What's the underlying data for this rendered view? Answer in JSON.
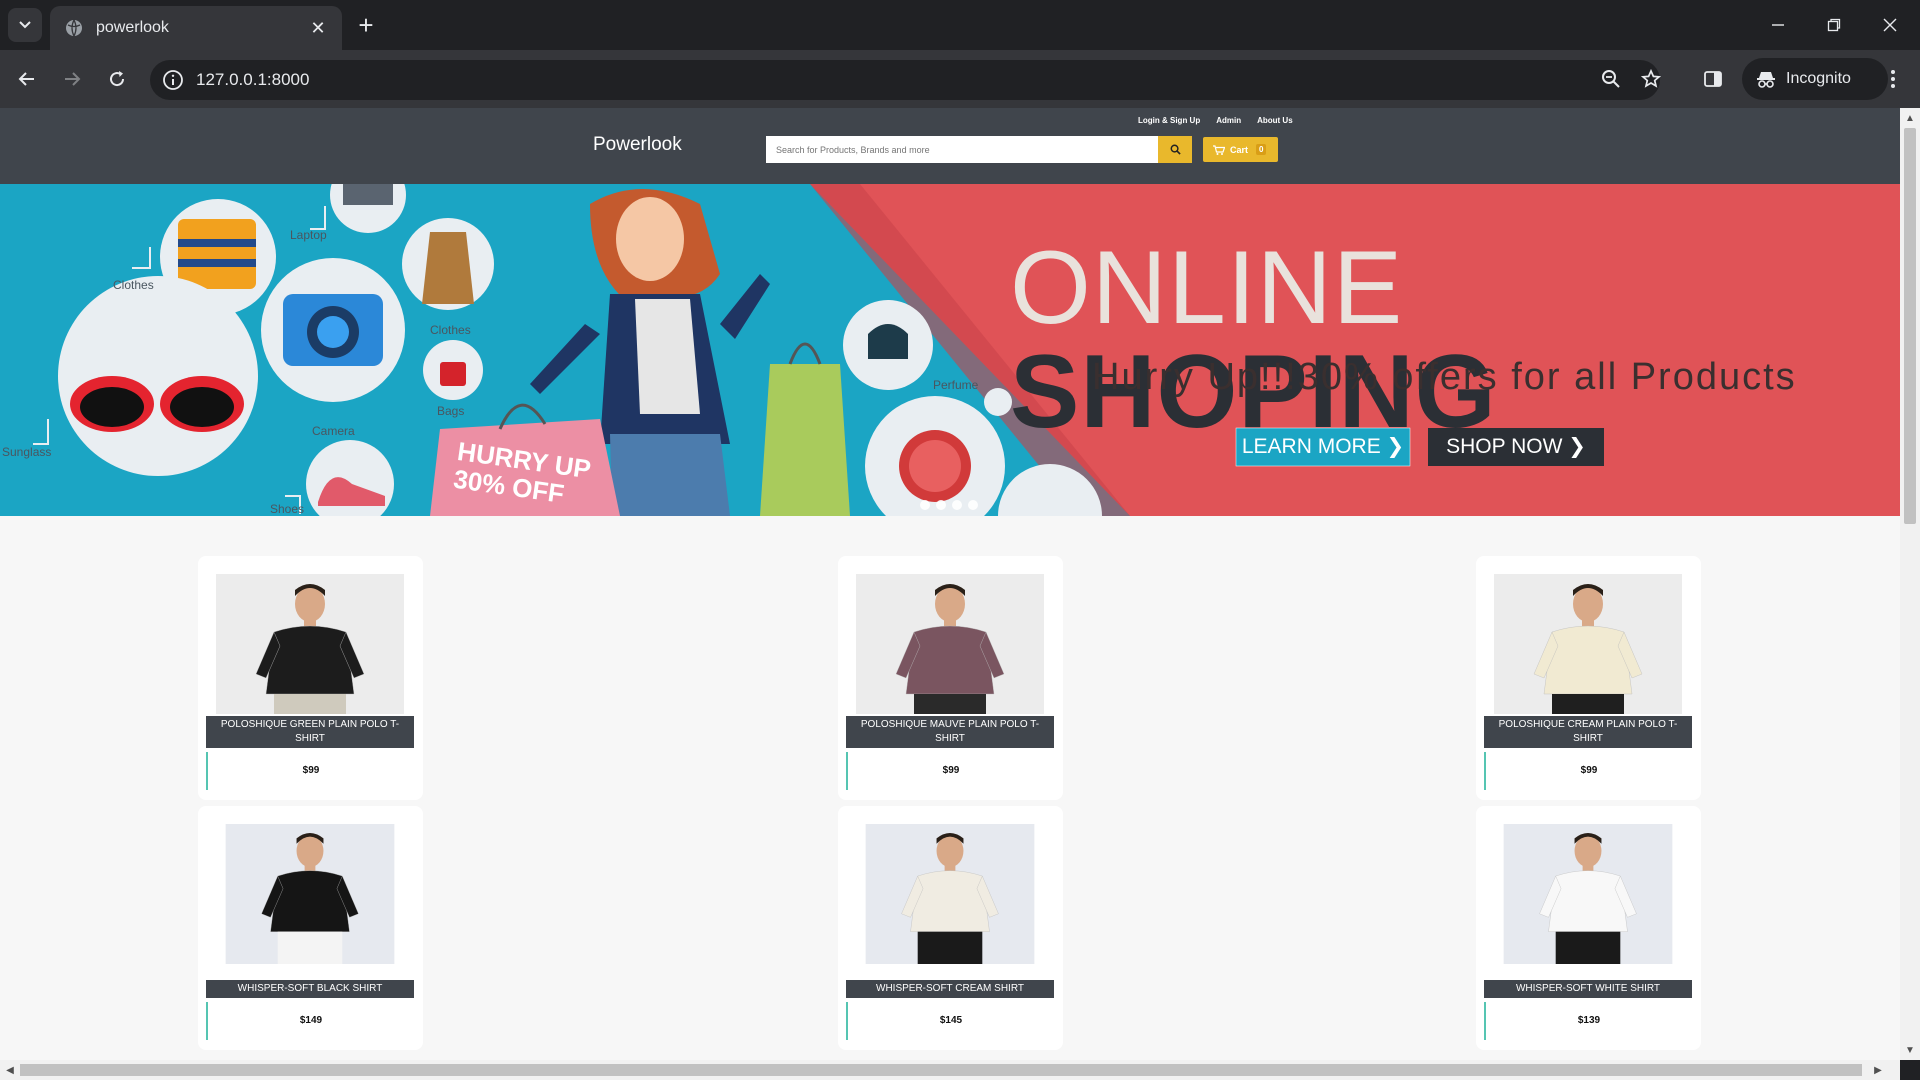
{
  "browser": {
    "tab_title": "powerlook",
    "url": "127.0.0.1:8000",
    "profile_label": "Incognito"
  },
  "site": {
    "brand": "Powerlook",
    "top_links": [
      "Login & Sign Up",
      "Admin",
      "About Us"
    ],
    "search_placeholder": "Search for Products, Brands and more",
    "cart_label": "Cart",
    "cart_count": "0"
  },
  "banner": {
    "headline_light": "ONLINE",
    "headline_bold": "SHOPING",
    "subline": "Hurry Up!!!30% offers for all Products",
    "learn_more": "LEARN MORE ❯",
    "shop_now": "SHOP NOW ❯",
    "bag_text_1": "HURRY UP",
    "bag_text_2": "30% OFF",
    "icon_labels": [
      "Clothes",
      "Laptop",
      "Clothes",
      "Sunglass",
      "Camera",
      "Bags",
      "Perfume",
      "Shoes"
    ]
  },
  "products": [
    {
      "name": "POLOSHIQUE GREEN PLAIN POLO T-SHIRT",
      "price": "$99",
      "shirt_color": "#1c1c1c",
      "pants_color": "#cfcabd",
      "bg": "#ececec"
    },
    {
      "name": "POLOSHIQUE MAUVE PLAIN POLO T-SHIRT",
      "price": "$99",
      "shirt_color": "#7a5560",
      "pants_color": "#2a2a2a",
      "bg": "#ececec"
    },
    {
      "name": "POLOSHIQUE CREAM PLAIN POLO T-SHIRT",
      "price": "$99",
      "shirt_color": "#f1ead2",
      "pants_color": "#1f1f1f",
      "bg": "#ececec"
    },
    {
      "name": "WHISPER-SOFT BLACK SHIRT",
      "price": "$149",
      "shirt_color": "#151515",
      "pants_color": "#f4f4f4",
      "bg": "#e6e9ef"
    },
    {
      "name": "WHISPER-SOFT CREAM SHIRT",
      "price": "$145",
      "shirt_color": "#f0ece2",
      "pants_color": "#1a1a1a",
      "bg": "#e6e9ef"
    },
    {
      "name": "WHISPER-SOFT WHITE SHIRT",
      "price": "$139",
      "shirt_color": "#f8f8f8",
      "pants_color": "#1a1a1a",
      "bg": "#e6e9ef"
    }
  ]
}
